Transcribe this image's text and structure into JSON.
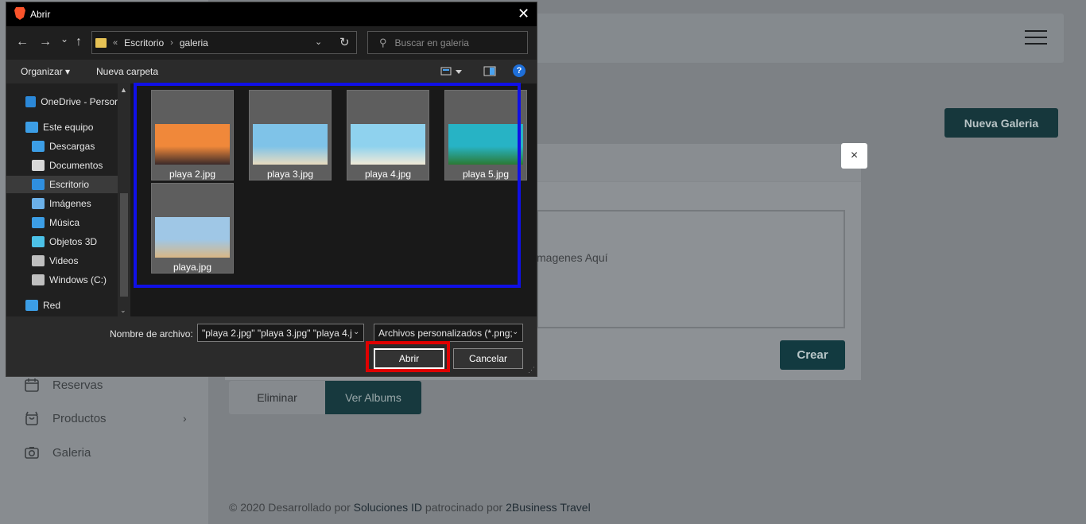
{
  "background_page": {
    "new_gallery_button": "Nueva Galeria",
    "sidebar": [
      {
        "label": "Reservas",
        "icon": "calendar-icon"
      },
      {
        "label": "Productos",
        "icon": "bag-icon",
        "has_chevron": true
      },
      {
        "label": "Galeria",
        "icon": "camera-icon"
      }
    ],
    "chevron": "›",
    "tabs": {
      "eliminar": "Eliminar",
      "ver_albums": "Ver Albums"
    },
    "modal": {
      "close": "×",
      "dropzone_text": "magenes Aquí",
      "create_button": "Crear"
    },
    "footer": {
      "prefix": "© 2020 Desarrollado por ",
      "company": "Soluciones ID",
      "middle": " patrocinado por ",
      "sponsor": "2Business Travel"
    }
  },
  "dialog": {
    "title": "Abrir",
    "close": "✕",
    "nav": {
      "back": "←",
      "forward": "→",
      "recent": "⌄",
      "up": "↑"
    },
    "address": {
      "prefix": "«",
      "crumbs": [
        "Escritorio",
        "galeria"
      ],
      "separator": "›"
    },
    "search_placeholder": "Buscar en galeria",
    "toolbar": {
      "organize": "Organizar ▾",
      "new_folder": "Nueva carpeta"
    },
    "navpane": [
      {
        "label": "OneDrive - Persor",
        "icon": "onedrive-icon",
        "color": "#2b88d8"
      },
      {
        "label": "Este equipo",
        "icon": "computer-icon",
        "color": "#3c9ee6"
      },
      {
        "label": "Descargas",
        "icon": "downloads-icon",
        "color": "#3c9ee6"
      },
      {
        "label": "Documentos",
        "icon": "documents-icon",
        "color": "#d8d8d8"
      },
      {
        "label": "Escritorio",
        "icon": "desktop-icon",
        "color": "#2f8fe0",
        "selected": true
      },
      {
        "label": "Imágenes",
        "icon": "pictures-icon",
        "color": "#6bb0e8"
      },
      {
        "label": "Música",
        "icon": "music-icon",
        "color": "#3c9ee6"
      },
      {
        "label": "Objetos 3D",
        "icon": "objects3d-icon",
        "color": "#4cc2e8"
      },
      {
        "label": "Videos",
        "icon": "videos-icon",
        "color": "#bfbfbf"
      },
      {
        "label": "Windows (C:)",
        "icon": "drive-icon",
        "color": "#bfbfbf"
      },
      {
        "label": "Red",
        "icon": "network-icon",
        "color": "#3c9ee6"
      }
    ],
    "files": [
      {
        "name": "playa 2.jpg",
        "palette": [
          "#f0883a",
          "#3a2a2a"
        ]
      },
      {
        "name": "playa 3.jpg",
        "palette": [
          "#7fc3e8",
          "#e9dcc0"
        ]
      },
      {
        "name": "playa 4.jpg",
        "palette": [
          "#8fd2ee",
          "#f1ead8"
        ]
      },
      {
        "name": "playa 5.jpg",
        "palette": [
          "#27b3c5",
          "#2b7a34"
        ]
      },
      {
        "name": "playa.jpg",
        "palette": [
          "#9fc7e6",
          "#d9b785"
        ]
      }
    ],
    "filename_label": "Nombre de archivo:",
    "filename_value": "\"playa 2.jpg\" \"playa 3.jpg\" \"playa 4.j",
    "filetype_value": "Archivos personalizados (*.png;",
    "open_button": "Abrir",
    "cancel_button": "Cancelar",
    "highlight_colors": {
      "selection_box": "#1010e6",
      "open_button_box": "#e00000"
    }
  }
}
